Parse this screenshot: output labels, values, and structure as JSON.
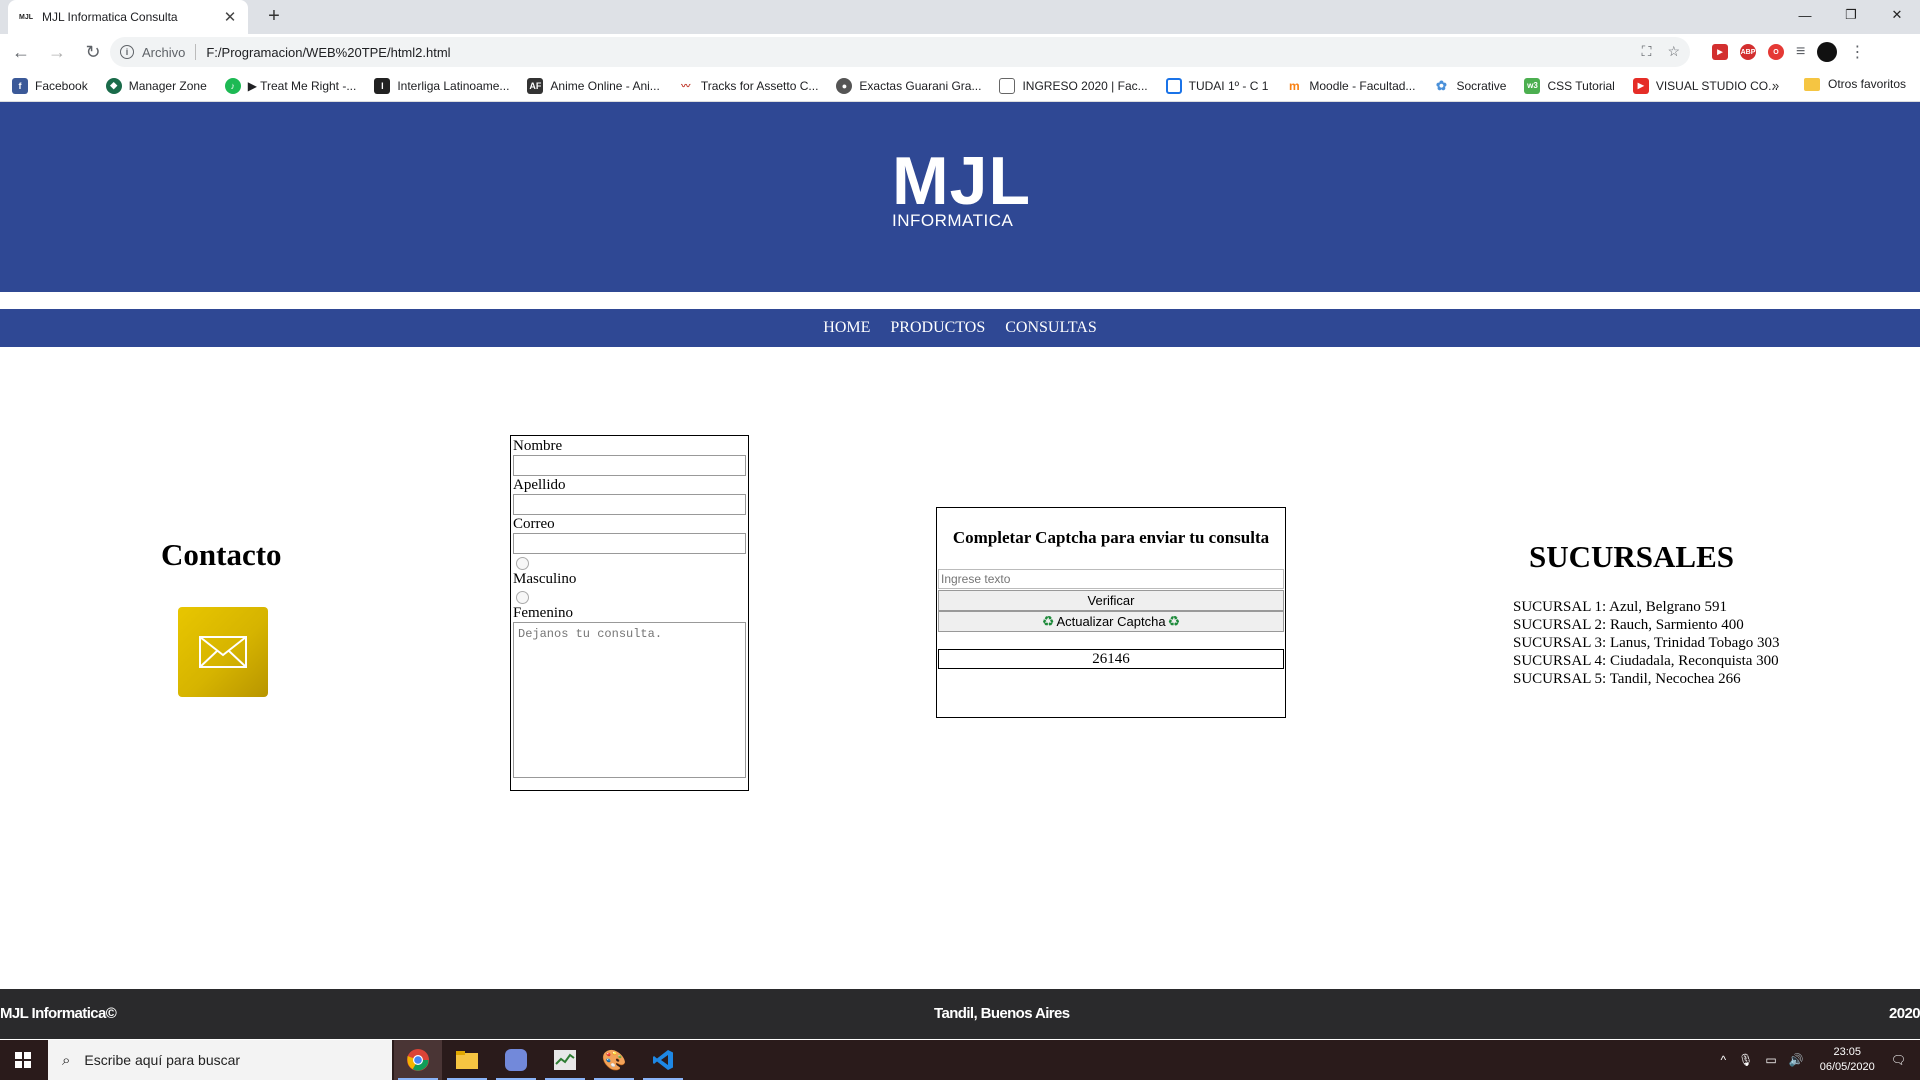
{
  "browser": {
    "tab_title": "MJL Informatica Consulta",
    "tab_favicon_text": "MJL",
    "address_scheme": "Archivo",
    "address_url": "F:/Programacion/WEB%20TPE/html2.html",
    "bookmarks": [
      {
        "label": "Facebook",
        "color": "#3b5998",
        "glyph": "f"
      },
      {
        "label": "Manager Zone",
        "color": "#1a6b4a",
        "glyph": "◆"
      },
      {
        "label": "▶ Treat Me Right -...",
        "color": "#1db954",
        "glyph": "♪"
      },
      {
        "label": "Interliga Latinoame...",
        "color": "#222222",
        "glyph": "I"
      },
      {
        "label": "Anime Online - Ani...",
        "color": "#333333",
        "glyph": "AF"
      },
      {
        "label": "Tracks for Assetto C...",
        "color": "#c0392b",
        "glyph": "~"
      },
      {
        "label": "Exactas Guarani Gra...",
        "color": "#555555",
        "glyph": "●"
      },
      {
        "label": "INGRESO 2020 | Fac...",
        "color": "#666666",
        "glyph": "▯"
      },
      {
        "label": "TUDAI 1º - C 1",
        "color": "#1a73e8",
        "glyph": "▭"
      },
      {
        "label": "Moodle - Facultad...",
        "color": "#f98012",
        "glyph": "m"
      },
      {
        "label": "Socrative",
        "color": "#4a90d9",
        "glyph": "✿"
      },
      {
        "label": "CSS Tutorial",
        "color": "#4caf50",
        "glyph": "w3"
      },
      {
        "label": "VISUAL STUDIO CO...",
        "color": "#e52d27",
        "glyph": "▶"
      }
    ],
    "bookmarks_more": "»",
    "other_bookmarks": "Otros favoritos"
  },
  "header": {
    "logo_main": "MJL",
    "logo_sub": "INFORMATICA"
  },
  "nav": {
    "items": [
      "HOME",
      "PRODUCTOS",
      "CONSULTAS"
    ]
  },
  "contact": {
    "title": "Contacto"
  },
  "form": {
    "nombre_label": "Nombre",
    "apellido_label": "Apellido",
    "correo_label": "Correo",
    "masculino_label": "Masculino",
    "femenino_label": "Femenino",
    "consulta_placeholder": "Dejanos tu consulta."
  },
  "captcha": {
    "title": "Completar Captcha para enviar tu consulta",
    "input_placeholder": "Ingrese texto",
    "verify_label": "Verificar",
    "refresh_label": "Actualizar Captcha",
    "code": "26146"
  },
  "sucursales": {
    "title": "SUCURSALES",
    "items": [
      "SUCURSAL 1: Azul, Belgrano 591",
      "SUCURSAL 2: Rauch, Sarmiento 400",
      "SUCURSAL 3: Lanus, Trinidad Tobago 303",
      "SUCURSAL 4: Ciudadala, Reconquista 300",
      "SUCURSAL 5: Tandil, Necochea 266"
    ]
  },
  "footer": {
    "left": "MJL Informatica©",
    "center": "Tandil, Buenos Aires",
    "right": "2020"
  },
  "taskbar": {
    "search_placeholder": "Escribe aquí para buscar",
    "time": "23:05",
    "date": "06/05/2020"
  },
  "colors": {
    "header_blue": "#2f4894",
    "footer_dark": "#2a2a2c",
    "mail_yellow": "#d6b400"
  }
}
